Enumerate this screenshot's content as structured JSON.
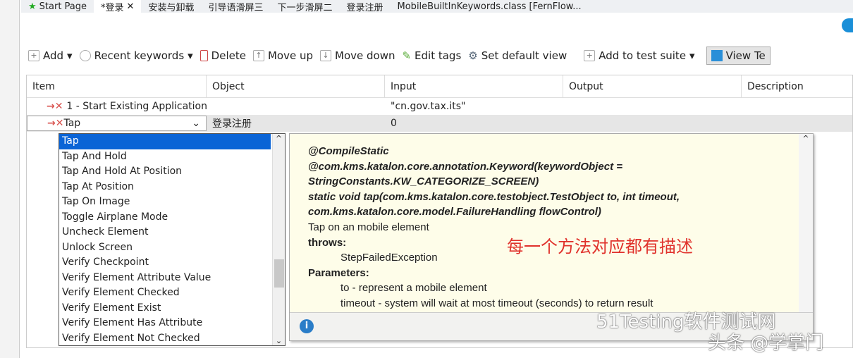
{
  "tabs": [
    "Start Page",
    "*登录",
    "安装与卸载",
    "引导语滑屏三",
    "下一步滑屏二",
    "登录注册",
    "MobileBuiltInKeywords.class [FernFlow..."
  ],
  "toolbar": {
    "add": "Add",
    "recent": "Recent keywords",
    "delete": "Delete",
    "move_up": "Move up",
    "move_down": "Move down",
    "edit_tags": "Edit tags",
    "set_default": "Set default view",
    "add_suite": "Add to test suite",
    "view": "View Te"
  },
  "columns": [
    "Item",
    "Object",
    "Input",
    "Output",
    "Description"
  ],
  "rows": [
    {
      "item": "1 - Start Existing Application",
      "object": "",
      "input": "\"cn.gov.tax.its\""
    },
    {
      "item": "Tap",
      "object": "登录注册",
      "input": "0"
    }
  ],
  "dropdown": [
    "Tap",
    "Tap And Hold",
    "Tap And Hold At Position",
    "Tap At Position",
    "Tap On Image",
    "Toggle Airplane Mode",
    "Uncheck Element",
    "Unlock Screen",
    "Verify Checkpoint",
    "Verify Element Attribute Value",
    "Verify Element Checked",
    "Verify Element Exist",
    "Verify Element Has Attribute",
    "Verify Element Not Checked"
  ],
  "doc": {
    "l1": "@CompileStatic",
    "l2": "@com.kms.katalon.core.annotation.Keyword(keywordObject =",
    "l3": "StringConstants.KW_CATEGORIZE_SCREEN)",
    "l4": "static void tap(com.kms.katalon.core.testobject.TestObject to, int timeout,",
    "l5": "com.kms.katalon.core.model.FailureHandling flowControl)",
    "desc": "Tap on an mobile element",
    "throws": "throws:",
    "exc": "StepFailedException",
    "params": "Parameters:",
    "p1": "to - represent a mobile element",
    "p2": "timeout - system will wait at most timeout (seconds) to return result",
    "note": "每一个方法对应都有描述"
  },
  "watermark": {
    "w1": "51Testing软件测试网",
    "w2": "头条 @学掌门"
  }
}
